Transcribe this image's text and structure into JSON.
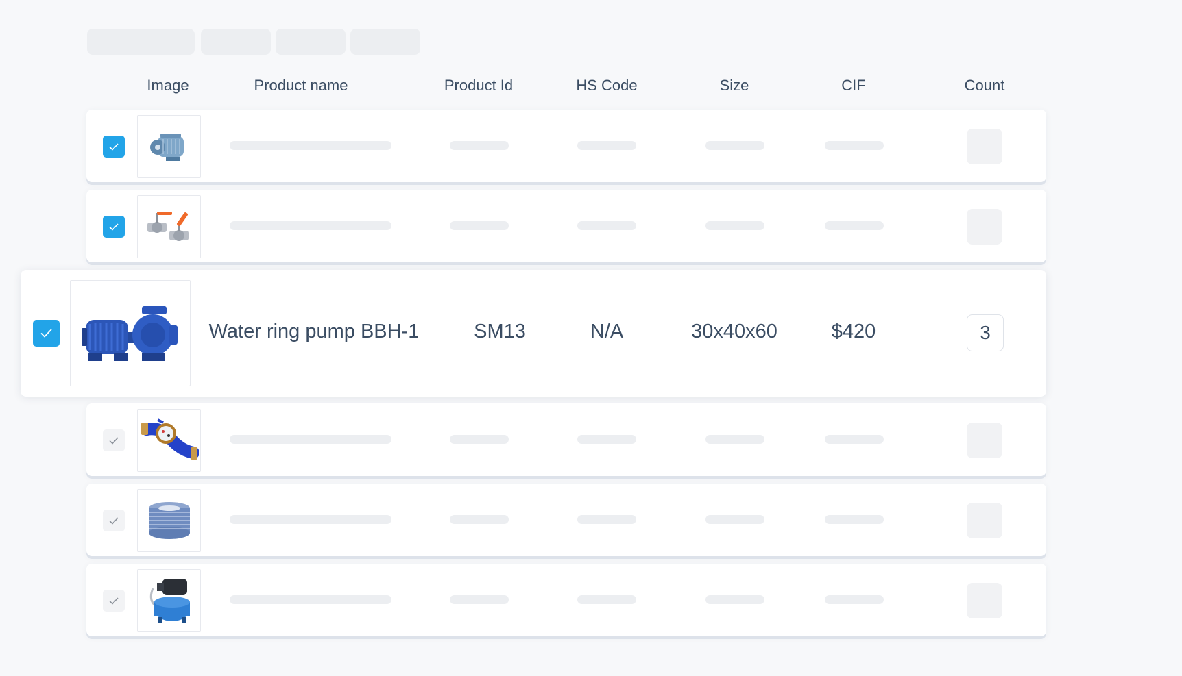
{
  "columns": {
    "image": "Image",
    "product_name": "Product name",
    "product_id": "Product Id",
    "hs_code": "HS Code",
    "size": "Size",
    "cif": "CIF",
    "count": "Count"
  },
  "rows": [
    {
      "checked": true,
      "image_icon": "electric-motor-icon"
    },
    {
      "checked": true,
      "image_icon": "ball-valve-icon"
    },
    {
      "checked": true,
      "image_icon": "water-ring-pump-icon",
      "product_name": "Water ring pump BBH-1",
      "product_id": "SM13",
      "hs_code": "N/A",
      "size": "30x40x60",
      "cif": "$420",
      "count": "3"
    },
    {
      "checked": false,
      "image_icon": "water-meter-icon"
    },
    {
      "checked": false,
      "image_icon": "hose-coil-icon"
    },
    {
      "checked": false,
      "image_icon": "pressure-pump-tank-icon"
    }
  ],
  "colors": {
    "accent": "#22a4e8",
    "text": "#3b4d63",
    "skeleton": "#eceef1",
    "background": "#f7f8fa"
  }
}
